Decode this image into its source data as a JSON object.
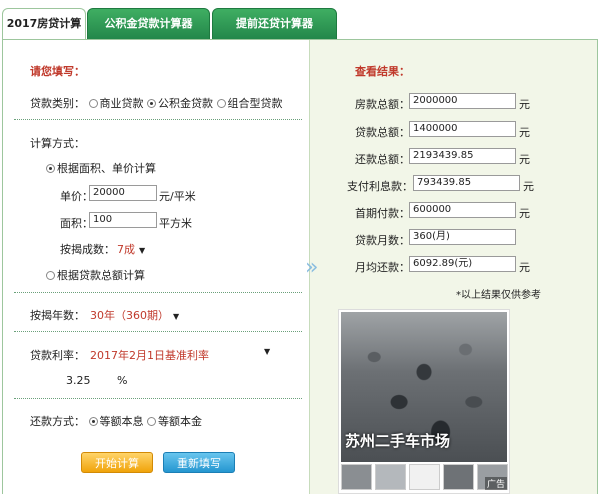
{
  "tabs": [
    "2017房贷计算器",
    "公积金贷款计算器",
    "提前还贷计算器"
  ],
  "form": {
    "title": "请您填写：",
    "loan_type_label": "贷款类别：",
    "loan_types": [
      "商业贷款",
      "公积金贷款",
      "组合型贷款"
    ],
    "calc_method_label": "计算方式：",
    "calc_by_area": "根据面积、单价计算",
    "unit_price_label": "单价：",
    "unit_price_value": "20000",
    "unit_price_unit": "元/平米",
    "area_label": "面积：",
    "area_value": "100",
    "area_unit": "平方米",
    "ratio_label": "按揭成数：",
    "ratio_value": "7成",
    "calc_by_total": "根据贷款总额计算",
    "years_label": "按揭年数：",
    "years_value": "30年（360期）",
    "rate_label": "贷款利率：",
    "rate_value": "2017年2月1日基准利率",
    "rate_number": "3.25",
    "rate_unit": "%",
    "repay_label": "还款方式：",
    "repay_methods": [
      "等额本息",
      "等额本金"
    ],
    "start_button": "开始计算",
    "reset_button": "重新填写"
  },
  "results": {
    "title": "查看结果：",
    "rows": [
      {
        "label": "房款总额：",
        "value": "2000000",
        "unit": "元"
      },
      {
        "label": "贷款总额：",
        "value": "1400000",
        "unit": "元"
      },
      {
        "label": "还款总额：",
        "value": "2193439.85",
        "unit": "元"
      },
      {
        "label": "支付利息款：",
        "value": "793439.85",
        "unit": "元"
      },
      {
        "label": "首期付款：",
        "value": "600000",
        "unit": "元"
      },
      {
        "label": "贷款月数：",
        "value": "360(月)",
        "unit": ""
      },
      {
        "label": "月均还款：",
        "value": "6092.89(元)",
        "unit": "元"
      }
    ],
    "note": "*以上结果仅供参考"
  },
  "ad": {
    "caption": "苏州二手车市场",
    "tag": "广告"
  },
  "icons": {
    "arrow": "double-chevron-right-icon",
    "dropdown": "triangle-down-icon"
  }
}
